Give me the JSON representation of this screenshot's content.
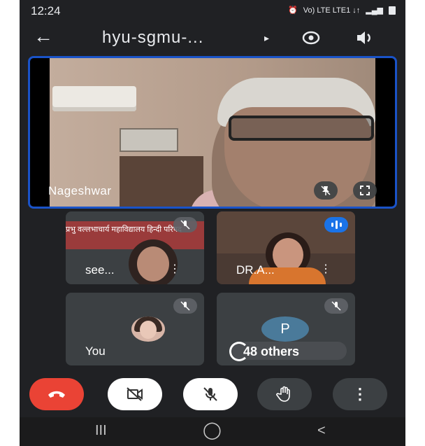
{
  "status": {
    "time": "12:24",
    "network": "Vo) LTE LTE1 ↓↑"
  },
  "topbar": {
    "back_icon": "arrow-back-icon",
    "title": "hyu-sgmu-...",
    "caret": "▸",
    "switch_camera_icon": "switch-camera-icon",
    "speaker_icon": "speaker-icon"
  },
  "main_participant": {
    "name": "Nageshwar",
    "pin_icon": "unpin-icon",
    "fullscreen_icon": "fullscreen-icon"
  },
  "tiles": [
    {
      "name": "see...",
      "menu": "⋮",
      "badge": "mic-off-icon",
      "banner_text": "प्रभु वल्लभाचार्य महाविद्यालय  हिन्दी  परिषद"
    },
    {
      "name": "DR.A...",
      "menu": "⋮",
      "badge": "speaking-indicator-icon"
    },
    {
      "name": "You",
      "badge": "mic-off-icon"
    },
    {
      "avatar_letter": "P",
      "others_label": "48 others",
      "badge": "mic-off-icon"
    }
  ],
  "controls": {
    "end_call": "end-call-icon",
    "camera": "camera-off-icon",
    "mic": "mic-off-icon",
    "hand": "raise-hand-icon",
    "more": "⋮"
  },
  "navbar": {
    "recents": "III",
    "home": "◯",
    "back": "<"
  },
  "colors": {
    "background": "#202124",
    "highlight_border": "#1a53c8",
    "end_call": "#ea4335",
    "tile": "#3c4043"
  }
}
